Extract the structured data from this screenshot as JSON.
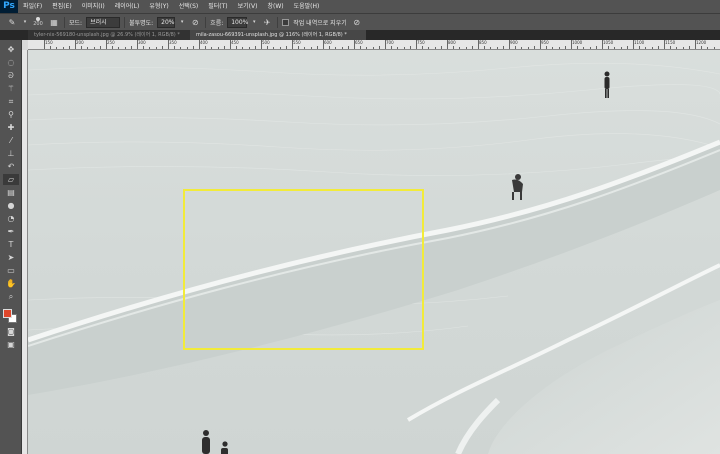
{
  "app": {
    "logo": "Ps"
  },
  "menu": [
    "파일(F)",
    "편집(E)",
    "이미지(I)",
    "레이어(L)",
    "유형(Y)",
    "선택(S)",
    "필터(T)",
    "보기(V)",
    "창(W)",
    "도움말(H)"
  ],
  "options": {
    "brush_size": "200",
    "mode_label": "모드:",
    "mode_value": "브러시",
    "opacity_label": "불투명도:",
    "opacity_value": "20%",
    "flow_label": "흐름:",
    "flow_value": "100%",
    "erase_history_label": "작업 내역으로 지우기"
  },
  "tabs": [
    {
      "title": "tyler-nix-569180-unsplash.jpg @ 26.9% (레이어 1, RGB/8) *",
      "active": false
    },
    {
      "title": "mila-zasou-669391-unsplash.jpg @ 116% (레이어 1, RGB/8) *",
      "active": true
    }
  ],
  "ruler_top_labels": [
    "150",
    "200",
    "250",
    "300",
    "350",
    "400",
    "450",
    "500",
    "550",
    "600",
    "650",
    "700",
    "750",
    "800",
    "850",
    "900",
    "950",
    "1000",
    "1050",
    "1100",
    "1150",
    "1200"
  ],
  "colors": {
    "foreground": "#e0472b",
    "background": "#ffffff",
    "selection": "#f2eb3a",
    "chrome": "#535353"
  },
  "tools": [
    "move-icon",
    "marquee-icon",
    "lasso-icon",
    "magic-wand-icon",
    "crop-icon",
    "eyedropper-icon",
    "healing-icon",
    "brush-icon",
    "stamp-icon",
    "history-brush-icon",
    "eraser-icon",
    "gradient-icon",
    "blur-icon",
    "dodge-icon",
    "pen-icon",
    "type-icon",
    "path-select-icon",
    "shape-icon",
    "hand-icon",
    "zoom-icon"
  ]
}
